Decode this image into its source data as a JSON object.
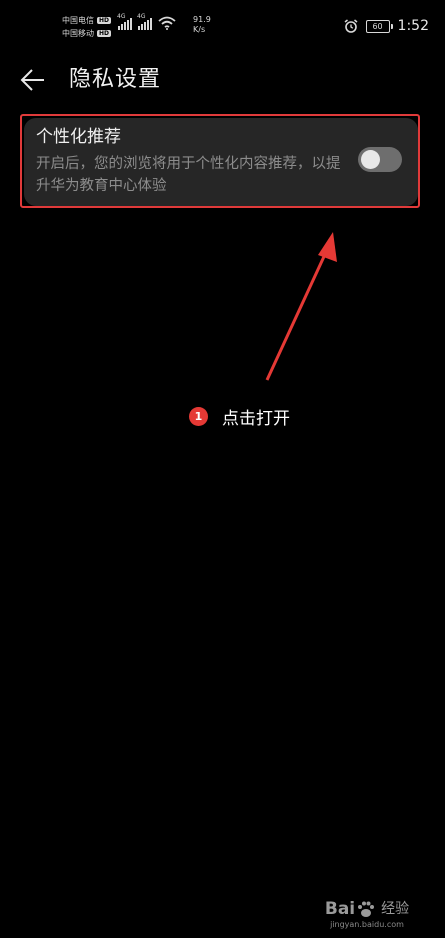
{
  "status_bar": {
    "carrier_1": "中国电信",
    "carrier_2": "中国移动",
    "hd_badge": "HD",
    "signal_tag_1": "4G",
    "signal_tag_2": "4G",
    "net_speed_value": "91.9",
    "net_speed_unit": "K/s",
    "battery_level": "60",
    "time": "1:52",
    "icons": [
      "signal-icon",
      "wifi-icon",
      "alarm-icon",
      "battery-icon"
    ]
  },
  "header": {
    "back_icon": "arrow-left-icon",
    "title": "隐私设置"
  },
  "setting": {
    "title": "个性化推荐",
    "description": "开启后，您的浏览将用于个性化内容推荐，以提升华为教育中心体验",
    "toggle_state": "off"
  },
  "annotation": {
    "step_number": "1",
    "step_text": "点击打开",
    "accent_color": "#e53935"
  },
  "watermark": {
    "logo_text_1": "Bai",
    "logo_text_2": "经验",
    "url": "jingyan.baidu.com"
  },
  "colors": {
    "background": "#000000",
    "card": "#262626",
    "highlight": "#e03a3a",
    "toggle_off": "#6e6e6e"
  }
}
